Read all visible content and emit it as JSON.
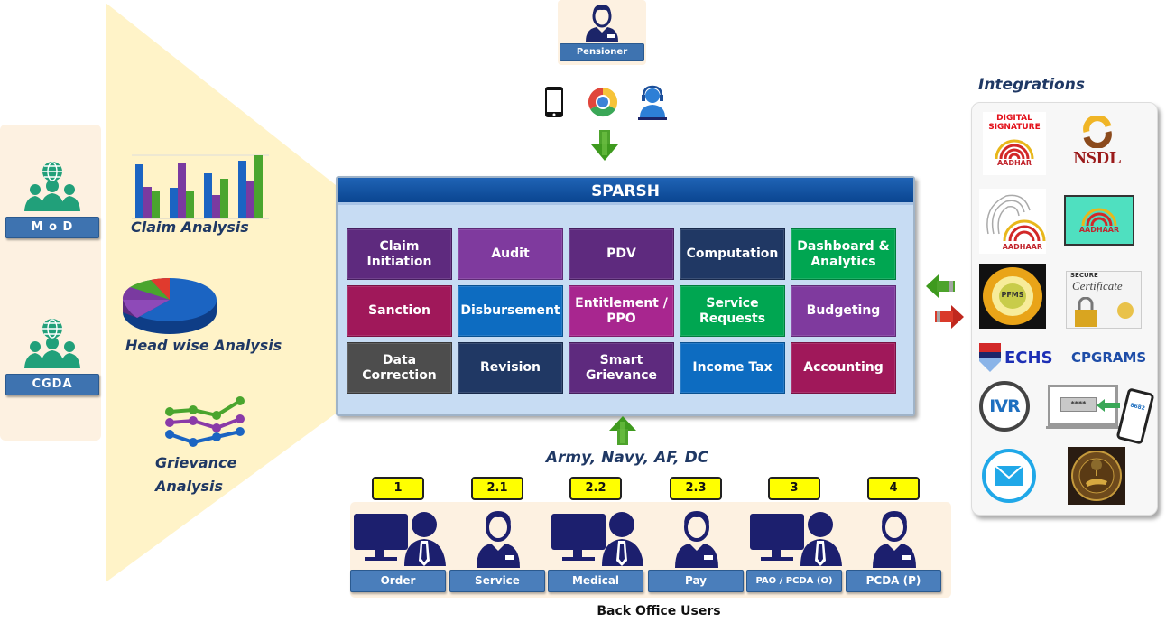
{
  "stakeholders": [
    {
      "label": "M o D",
      "icon": "people-globe-icon"
    },
    {
      "label": "CGDA",
      "icon": "people-globe-icon"
    }
  ],
  "analysis": [
    {
      "label": "Claim Analysis",
      "icon": "bar-chart-icon"
    },
    {
      "label": "Head wise Analysis",
      "icon": "pie-chart-icon"
    },
    {
      "label": "Grievance Analysis",
      "icon": "line-chart-icon"
    }
  ],
  "pensioner": {
    "label": "Pensioner",
    "channels": [
      {
        "name": "mobile",
        "icon": "mobile-phone-icon"
      },
      {
        "name": "web",
        "icon": "chrome-browser-icon"
      },
      {
        "name": "call-center",
        "icon": "headset-agent-icon"
      }
    ]
  },
  "sparsh": {
    "title": "SPARSH",
    "modules": [
      {
        "label": "Claim\nInitiation",
        "color": "#5e2a7e"
      },
      {
        "label": "Audit",
        "color": "#7f3a9e"
      },
      {
        "label": "PDV",
        "color": "#5e2a7e"
      },
      {
        "label": "Computation",
        "color": "#203864"
      },
      {
        "label": "Dashboard &\nAnalytics",
        "color": "#00a651"
      },
      {
        "label": "Sanction",
        "color": "#a0185a"
      },
      {
        "label": "Disbursement",
        "color": "#0d6cc1"
      },
      {
        "label": "Entitlement /\nPPO",
        "color": "#a8268f"
      },
      {
        "label": "Service\nRequests",
        "color": "#00a651"
      },
      {
        "label": "Budgeting",
        "color": "#7f3a9e"
      },
      {
        "label": "Data\nCorrection",
        "color": "#4d4d4d"
      },
      {
        "label": "Revision",
        "color": "#203864"
      },
      {
        "label": "Smart\nGrievance",
        "color": "#5e2a7e"
      },
      {
        "label": "Income Tax",
        "color": "#0d6cc1"
      },
      {
        "label": "Accounting",
        "color": "#a0185a"
      }
    ]
  },
  "back_office": {
    "forces_label": "Army, Navy, AF, DC",
    "caption": "Back Office Users",
    "users": [
      {
        "step": "1",
        "label": "Order",
        "icon": "desktop-user-icon"
      },
      {
        "step": "2.1",
        "label": "Service",
        "icon": "officer-icon"
      },
      {
        "step": "2.2",
        "label": "Medical",
        "icon": "desktop-user-icon"
      },
      {
        "step": "2.3",
        "label": "Pay",
        "icon": "officer-icon"
      },
      {
        "step": "3",
        "label": "PAO / PCDA (O)",
        "icon": "desktop-user-icon"
      },
      {
        "step": "4",
        "label": "PCDA (P)",
        "icon": "officer-icon"
      }
    ]
  },
  "integrations": {
    "title": "Integrations",
    "logos": [
      {
        "name": "digital-signature-aadhar",
        "line1": "DIGITAL",
        "line2": "SIGNATURE",
        "line3": "AADHAR"
      },
      {
        "name": "nsdl",
        "text": "NSDL"
      },
      {
        "name": "aadhaar-biometric",
        "text": "AADHAAR"
      },
      {
        "name": "aadhaar-card",
        "text": "AADHAAR"
      },
      {
        "name": "pfms",
        "text": "PFMS"
      },
      {
        "name": "secure-certificate",
        "line1": "SECURE",
        "line2": "Certificate"
      },
      {
        "name": "echs",
        "text": "ECHS"
      },
      {
        "name": "cpgrams",
        "text": "CPGRAMS"
      },
      {
        "name": "ivr",
        "text": "IVR"
      },
      {
        "name": "otp-verification",
        "text": "****",
        "code": "8682"
      },
      {
        "name": "email",
        "icon": "email-icon"
      },
      {
        "name": "rbi",
        "icon": "rbi-seal-icon"
      }
    ]
  },
  "colors": {
    "funnel": "#fff3c8",
    "panel_bg": "#fdf1e1",
    "label_blue": "#3e73b0",
    "navy": "#14235e",
    "sparsh_header": "#0a4590",
    "badge_yellow": "#ffff00"
  }
}
